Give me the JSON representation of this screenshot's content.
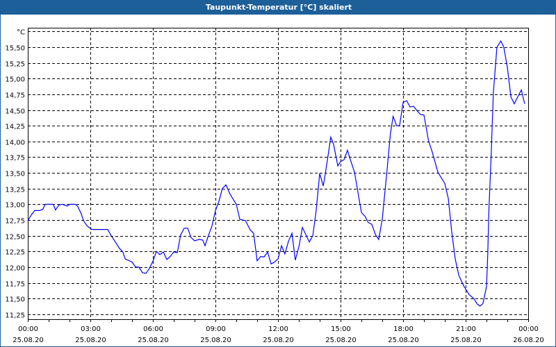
{
  "window": {
    "title": "Taupunkt-Temperatur [°C] skaliert"
  },
  "colors": {
    "titlebar": "#1d5f98",
    "series": "#0000ff",
    "grid": "#000000"
  },
  "chart_data": {
    "type": "line",
    "title": "Taupunkt-Temperatur [°C] skaliert",
    "ylabel": "°C",
    "xlabel": "",
    "ylim": [
      11.17,
      15.81
    ],
    "xlim_hours": [
      0,
      24
    ],
    "grid": true,
    "y_ticks": [
      {
        "value": 15.75,
        "label": "°C"
      },
      {
        "value": 15.5,
        "label": "15,50"
      },
      {
        "value": 15.25,
        "label": "15,25"
      },
      {
        "value": 15.0,
        "label": "15,00"
      },
      {
        "value": 14.75,
        "label": "14,75"
      },
      {
        "value": 14.5,
        "label": "14,50"
      },
      {
        "value": 14.25,
        "label": "14,25"
      },
      {
        "value": 14.0,
        "label": "14,00"
      },
      {
        "value": 13.75,
        "label": "13,75"
      },
      {
        "value": 13.5,
        "label": "13,50"
      },
      {
        "value": 13.25,
        "label": "13,25"
      },
      {
        "value": 13.0,
        "label": "13,00"
      },
      {
        "value": 12.75,
        "label": "12,75"
      },
      {
        "value": 12.5,
        "label": "12,50"
      },
      {
        "value": 12.25,
        "label": "12,25"
      },
      {
        "value": 12.0,
        "label": "12,00"
      },
      {
        "value": 11.75,
        "label": "11,75"
      },
      {
        "value": 11.5,
        "label": "11,50"
      },
      {
        "value": 11.25,
        "label": "11,25"
      }
    ],
    "x_ticks": [
      {
        "hour": 0,
        "time": "00:00",
        "date": "25.08.20"
      },
      {
        "hour": 3,
        "time": "03:00",
        "date": "25.08.20"
      },
      {
        "hour": 6,
        "time": "06:00",
        "date": "25.08.20"
      },
      {
        "hour": 9,
        "time": "09:00",
        "date": "25.08.20"
      },
      {
        "hour": 12,
        "time": "12:00",
        "date": "25.08.20"
      },
      {
        "hour": 15,
        "time": "15:00",
        "date": "25.08.20"
      },
      {
        "hour": 18,
        "time": "18:00",
        "date": "25.08.20"
      },
      {
        "hour": 21,
        "time": "21:00",
        "date": "25.08.20"
      },
      {
        "hour": 24,
        "time": "00:00",
        "date": "26.08.20"
      }
    ],
    "series": [
      {
        "name": "Taupunkt-Temperatur",
        "x_hours": [
          0,
          0.17,
          0.33,
          0.56,
          0.72,
          0.83,
          1.22,
          1.33,
          1.5,
          1.67,
          1.89,
          2,
          2.27,
          2.39,
          2.56,
          2.67,
          2.83,
          3.06,
          3.83,
          4,
          4.22,
          4.39,
          4.56,
          4.67,
          5,
          5.17,
          5.33,
          5.5,
          5.67,
          5.83,
          6,
          6.17,
          6.33,
          6.5,
          6.67,
          6.83,
          7,
          7.17,
          7.33,
          7.5,
          7.67,
          7.83,
          8,
          8.22,
          8.39,
          8.5,
          8.67,
          8.83,
          9,
          9.17,
          9.33,
          9.5,
          9.67,
          9.83,
          10,
          10.17,
          10.44,
          10.67,
          10.83,
          11,
          11.17,
          11.33,
          11.5,
          11.67,
          11.83,
          12,
          12.17,
          12.33,
          12.5,
          12.67,
          12.83,
          13,
          13.17,
          13.33,
          13.5,
          13.67,
          13.83,
          14,
          14.17,
          14.28,
          14.39,
          14.53,
          14.67,
          14.87,
          15,
          15.17,
          15.33,
          15.5,
          15.67,
          15.83,
          16,
          16.17,
          16.33,
          16.5,
          16.67,
          16.83,
          17,
          17.22,
          17.39,
          17.52,
          17.69,
          17.83,
          18,
          18.17,
          18.33,
          18.5,
          18.67,
          18.83,
          19,
          19.22,
          19.39,
          19.56,
          19.67,
          20,
          20.17,
          20.33,
          20.5,
          20.67,
          20.89,
          21.17,
          21.39,
          21.56,
          21.69,
          21.83,
          22,
          22.06,
          22.11,
          22.22,
          22.33,
          22.5,
          22.69,
          22.83,
          23,
          23.17,
          23.33,
          23.67,
          23.83
        ],
        "values": [
          12.74,
          12.83,
          12.9,
          12.9,
          12.92,
          13.0,
          13.0,
          12.91,
          12.99,
          13.0,
          12.97,
          13.0,
          13.0,
          12.97,
          12.85,
          12.74,
          12.66,
          12.6,
          12.6,
          12.5,
          12.39,
          12.3,
          12.24,
          12.13,
          12.08,
          12.0,
          12.0,
          11.91,
          11.9,
          11.98,
          12.09,
          12.25,
          12.2,
          12.24,
          12.12,
          12.17,
          12.24,
          12.23,
          12.51,
          12.62,
          12.62,
          12.47,
          12.42,
          12.44,
          12.43,
          12.34,
          12.51,
          12.65,
          12.9,
          13.05,
          13.25,
          13.31,
          13.18,
          13.09,
          13.0,
          12.76,
          12.74,
          12.59,
          12.54,
          12.1,
          12.17,
          12.16,
          12.24,
          12.05,
          12.08,
          12.13,
          12.34,
          12.21,
          12.41,
          12.54,
          12.11,
          12.32,
          12.63,
          12.52,
          12.4,
          12.5,
          12.9,
          13.49,
          13.29,
          13.51,
          13.75,
          14.07,
          13.95,
          13.61,
          13.68,
          13.71,
          13.86,
          13.68,
          13.51,
          13.2,
          12.87,
          12.81,
          12.71,
          12.68,
          12.52,
          12.44,
          12.76,
          13.51,
          14.12,
          14.4,
          14.25,
          14.25,
          14.62,
          14.65,
          14.55,
          14.56,
          14.49,
          14.43,
          14.42,
          14.01,
          13.84,
          13.64,
          13.51,
          13.33,
          13.09,
          12.57,
          12.13,
          11.87,
          11.71,
          11.56,
          11.5,
          11.41,
          11.38,
          11.42,
          11.69,
          12.2,
          12.87,
          13.75,
          14.78,
          15.5,
          15.6,
          15.5,
          15.18,
          14.71,
          14.6,
          14.82,
          14.6
        ]
      }
    ]
  }
}
